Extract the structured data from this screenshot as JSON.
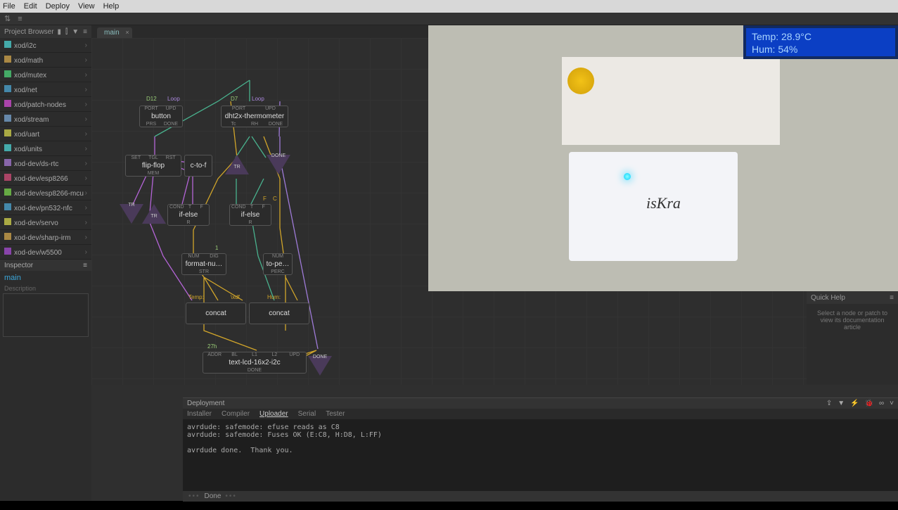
{
  "menu": {
    "file": "File",
    "edit": "Edit",
    "deploy": "Deploy",
    "view": "View",
    "help": "Help"
  },
  "project_browser": {
    "title": "Project Browser",
    "libs": [
      {
        "name": "xod/i2c",
        "color": "#4aa"
      },
      {
        "name": "xod/math",
        "color": "#a84"
      },
      {
        "name": "xod/mutex",
        "color": "#4a6"
      },
      {
        "name": "xod/net",
        "color": "#48a"
      },
      {
        "name": "xod/patch-nodes",
        "color": "#a4a"
      },
      {
        "name": "xod/stream",
        "color": "#68a"
      },
      {
        "name": "xod/uart",
        "color": "#aa4"
      },
      {
        "name": "xod/units",
        "color": "#4aa"
      },
      {
        "name": "xod-dev/ds-rtc",
        "color": "#86a"
      },
      {
        "name": "xod-dev/esp8266",
        "color": "#a46"
      },
      {
        "name": "xod-dev/esp8266-mcu",
        "color": "#6a4"
      },
      {
        "name": "xod-dev/pn532-nfc",
        "color": "#48a"
      },
      {
        "name": "xod-dev/servo",
        "color": "#aa4"
      },
      {
        "name": "xod-dev/sharp-irm",
        "color": "#a84"
      },
      {
        "name": "xod-dev/w5500",
        "color": "#84a"
      }
    ]
  },
  "inspector": {
    "title": "Inspector",
    "patch": "main",
    "desc_label": "Description"
  },
  "tab": {
    "name": "main"
  },
  "nodes": {
    "button": {
      "title": "button",
      "pin_port": "PORT",
      "pin_upd": "UPD",
      "val_port": "D12",
      "val_loop": "Loop",
      "pin_prs": "PRS",
      "pin_done": "DONE"
    },
    "dht": {
      "title": "dht2x-thermometer",
      "pin_port": "PORT",
      "pin_upd": "UPD",
      "val_port": "D7",
      "val_loop": "Loop",
      "pin_tc": "Tc",
      "pin_rh": "RH",
      "pin_done": "DONE"
    },
    "flipflop": {
      "title": "flip-flop",
      "pin_set": "SET",
      "pin_tgl": "TGL",
      "pin_rst": "RST",
      "pin_mem": "MEM"
    },
    "ctof": {
      "title": "c-to-f"
    },
    "tr1": "TR",
    "done1": "DONE",
    "tr2": "TR",
    "tr3": "TR",
    "ifelse1": {
      "title": "if-else",
      "pin_cond": "COND",
      "pin_t": "T",
      "pin_f": "F",
      "pin_r": "R",
      "val_c": "C"
    },
    "ifelse2": {
      "title": "if-else",
      "pin_cond": "COND",
      "pin_t": "T",
      "pin_f": "F",
      "pin_r": "R"
    },
    "fmtnum": {
      "title": "format-nu…",
      "pin_num": "NUM",
      "pin_dig": "DIG",
      "pin_str": "STR",
      "val_dig": "1"
    },
    "tope": {
      "title": "to-pe…",
      "pin_num": "NUM",
      "pin_perc": "PERC"
    },
    "concat1": {
      "title": "concat",
      "lbl1": "Temp:",
      "lbl2": "\\xdf"
    },
    "concat2": {
      "title": "concat",
      "lbl1": "Hum:"
    },
    "lcd": {
      "title": "text-lcd-16x2-i2c",
      "pin_addr": "ADDR",
      "pin_bl": "BL",
      "pin_l1": "L1",
      "pin_l2": "L2",
      "pin_upd": "UPD",
      "pin_done": "DONE",
      "val_addr": "27h"
    },
    "donelcd": "DONE"
  },
  "quickhelp": {
    "title": "Quick Help",
    "text": "Select a node or patch to view its documentation article"
  },
  "deployment": {
    "title": "Deployment",
    "tabs": {
      "installer": "Installer",
      "compiler": "Compiler",
      "uploader": "Uploader",
      "serial": "Serial",
      "tester": "Tester"
    },
    "log": "avrdude: safemode: efuse reads as C8\navrdude: safemode: Fuses OK (E:C8, H:D8, L:FF)\n\navrdude done.  Thank you.\n",
    "status": "Done"
  },
  "webcam": {
    "lcd_line1": "Temp: 28.9°C",
    "lcd_line2": "Hum: 54%",
    "board": "isKra"
  }
}
